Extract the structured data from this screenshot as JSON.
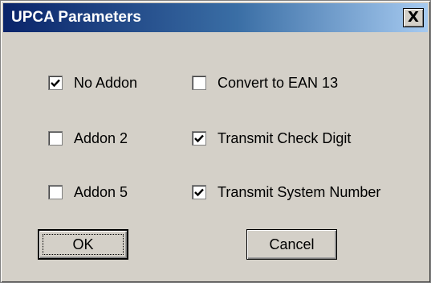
{
  "dialog": {
    "title": "UPCA Parameters",
    "close_label": "X"
  },
  "options": [
    {
      "label": "No Addon",
      "checked": true
    },
    {
      "label": "Addon 2",
      "checked": false
    },
    {
      "label": "Addon 5",
      "checked": false
    },
    {
      "label": "Convert to EAN 13",
      "checked": false
    },
    {
      "label": "Transmit Check Digit",
      "checked": true
    },
    {
      "label": "Transmit System Number",
      "checked": true
    }
  ],
  "buttons": {
    "ok_label": "OK",
    "cancel_label": "Cancel"
  }
}
